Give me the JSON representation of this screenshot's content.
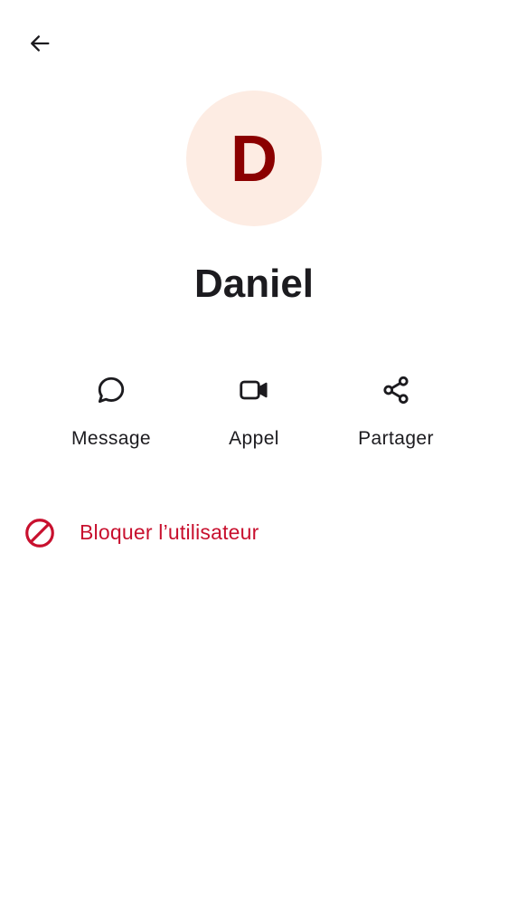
{
  "header": {
    "back_icon": "arrow-back-icon"
  },
  "contact": {
    "initial": "D",
    "name": "Daniel",
    "avatar_bg": "#fdece3",
    "initial_color": "#8b0000"
  },
  "actions": [
    {
      "label": "Message",
      "icon": "chat-bubble-icon"
    },
    {
      "label": "Appel",
      "icon": "video-camera-icon"
    },
    {
      "label": "Partager",
      "icon": "share-icon"
    }
  ],
  "block": {
    "label": "Bloquer l’utilisateur",
    "icon": "block-icon",
    "color": "#c8102e"
  }
}
